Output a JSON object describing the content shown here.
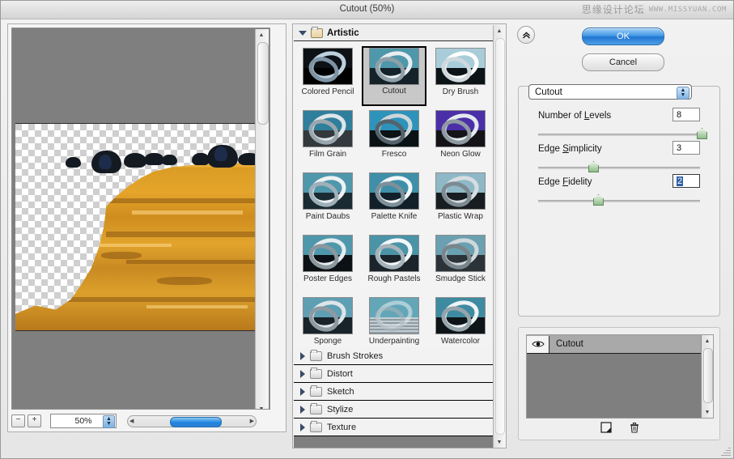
{
  "window": {
    "title": "Cutout (50%)",
    "watermark_cn": "思缘设计论坛",
    "watermark_en": "WWW.MISSYUAN.COM"
  },
  "preview": {
    "zoom_out_label": "−",
    "zoom_in_label": "+",
    "zoom_value": "50%",
    "scroll_left_icon": "◀",
    "scroll_right_icon": "▶"
  },
  "gallery": {
    "open_category": "Artistic",
    "selected_filter": "Cutout",
    "filters": [
      {
        "label": "Colored Pencil",
        "sky": "#0d1116",
        "ground": "#000000",
        "ring": "#bcd0dd",
        "ring2": "#7e93a4"
      },
      {
        "label": "Cutout",
        "sky": "#4f97ab",
        "ground": "#15222a",
        "ring": "#e8eef1",
        "ring2": "#90a0a8"
      },
      {
        "label": "Dry Brush",
        "sky": "#a8cdd9",
        "ground": "#0c1418",
        "ring": "#ffffff",
        "ring2": "#cfd8dd"
      },
      {
        "label": "Film Grain",
        "sky": "#2f7f9c",
        "ground": "#33393c",
        "ring": "#dfe6ea",
        "ring2": "#9aa6ad"
      },
      {
        "label": "Fresco",
        "sky": "#2e93bb",
        "ground": "#0a1216",
        "ring": "#cdd6da",
        "ring2": "#53626b"
      },
      {
        "label": "Neon Glow",
        "sky": "#4a2fa8",
        "ground": "#141418",
        "ring": "#e3e9ee",
        "ring2": "#8e99a2"
      },
      {
        "label": "Paint Daubs",
        "sky": "#4f97ab",
        "ground": "#1b2b33",
        "ring": "#eef2f4",
        "ring2": "#9fb0b8"
      },
      {
        "label": "Palette Knife",
        "sky": "#3f8fa8",
        "ground": "#12202a",
        "ring": "#f2f6f8",
        "ring2": "#7e9099"
      },
      {
        "label": "Plastic Wrap",
        "sky": "#8fb8c6",
        "ground": "#171d20",
        "ring": "#d6dde1",
        "ring2": "#7d8a92"
      },
      {
        "label": "Poster Edges",
        "sky": "#4f97ab",
        "ground": "#0b1114",
        "ring": "#e6ecef",
        "ring2": "#8b979e"
      },
      {
        "label": "Rough Pastels",
        "sky": "#4b93a7",
        "ground": "#1a242a",
        "ring": "#f3f7f9",
        "ring2": "#a6b3ba"
      },
      {
        "label": "Smudge Stick",
        "sky": "#6aa0b0",
        "ground": "#2b3338",
        "ring": "#cfd8dc",
        "ring2": "#79858c"
      },
      {
        "label": "Sponge",
        "sky": "#5f9fb3",
        "ground": "#19232a",
        "ring": "#dde5e9",
        "ring2": "#8e9aa1"
      },
      {
        "label": "Underpainting",
        "sky": "#63a6b8",
        "ground": "#8d9aa1",
        "ring": "#e7eef1",
        "ring2": "#aab5bb"
      },
      {
        "label": "Watercolor",
        "sky": "#3e8ba1",
        "ground": "#0d1519",
        "ring": "#eef3f5",
        "ring2": "#96a4ab"
      }
    ],
    "categories": [
      {
        "label": "Brush Strokes"
      },
      {
        "label": "Distort"
      },
      {
        "label": "Sketch"
      },
      {
        "label": "Stylize"
      },
      {
        "label": "Texture"
      }
    ]
  },
  "buttons": {
    "ok": "OK",
    "cancel": "Cancel",
    "collapse_icon": "«"
  },
  "settings": {
    "filter_name": "Cutout",
    "controls": [
      {
        "label_pre": "Number of ",
        "label_key": "L",
        "label_post": "evels",
        "value": "8",
        "slider_pct": 99,
        "focused": false
      },
      {
        "label_pre": "Edge ",
        "label_key": "S",
        "label_post": "implicity",
        "value": "3",
        "slider_pct": 31,
        "focused": false
      },
      {
        "label_pre": "Edge ",
        "label_key": "F",
        "label_post": "idelity",
        "value": "2",
        "slider_pct": 34,
        "focused": true
      }
    ]
  },
  "layers": {
    "rows": [
      {
        "name": "Cutout",
        "visible": true
      }
    ],
    "new_layer_icon": "new-effect-layer",
    "delete_icon": "trash"
  }
}
